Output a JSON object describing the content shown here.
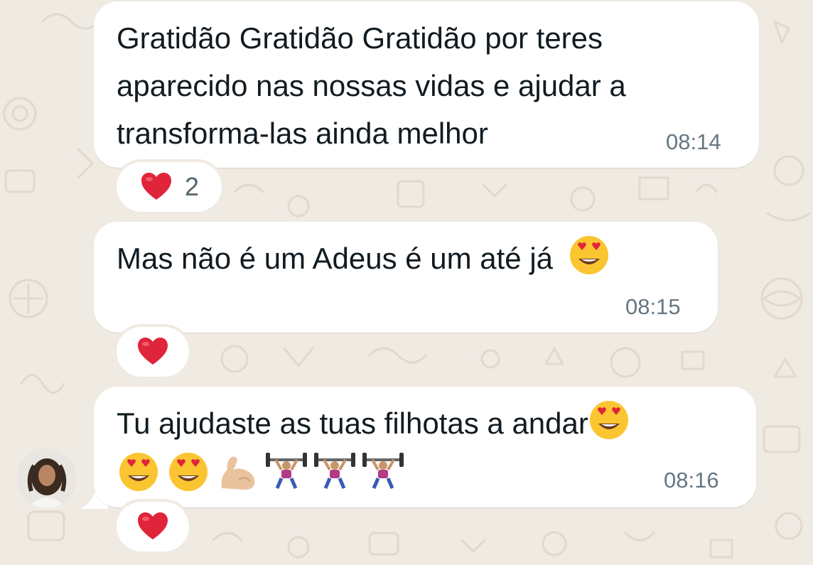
{
  "messages": [
    {
      "lines": [
        "Gratidão Gratidão Gratidão por teres",
        "aparecido nas nossas vidas e ajudar a",
        "transforma-las ainda melhor"
      ],
      "time": "08:14",
      "reaction": {
        "emoji": "heart",
        "count": "2"
      }
    },
    {
      "lines": [
        "Mas não é um Adeus é um até já"
      ],
      "emojis": [
        "smiling-face-with-heart-eyes"
      ],
      "time": "08:15",
      "reaction": {
        "emoji": "heart"
      }
    },
    {
      "lines": [
        "Tu ajudaste as tuas filhotas a andar"
      ],
      "emojis": [
        "smiling-face-with-heart-eyes",
        "smiling-face-with-heart-eyes",
        "smiling-face-with-heart-eyes",
        "flexed-biceps",
        "woman-lifting-weights",
        "woman-lifting-weights",
        "woman-lifting-weights"
      ],
      "time": "08:16",
      "reaction": {
        "emoji": "heart"
      }
    }
  ],
  "colors": {
    "wallpaper": "#efeae2",
    "bubble": "#ffffff",
    "text": "#111b21",
    "timestamp": "#667781",
    "heart": "#e0243a"
  }
}
